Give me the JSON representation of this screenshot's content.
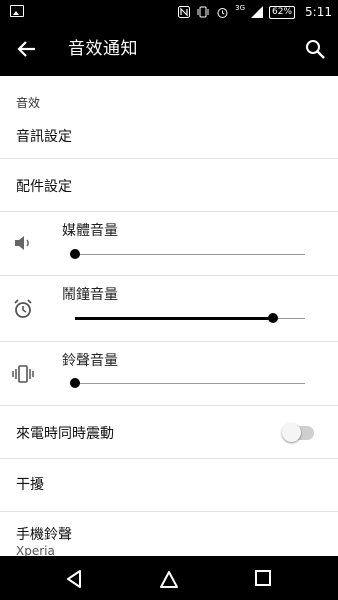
{
  "status_bar": {
    "battery": "62%",
    "time": "5:11",
    "network": "3G",
    "icons": [
      "image-icon",
      "nfc-icon",
      "vibrate-icon",
      "alarm-icon",
      "signal-icon",
      "battery-icon"
    ]
  },
  "app_bar": {
    "title": "音效通知",
    "back_icon": "arrow-back-icon",
    "search_icon": "search-icon"
  },
  "content": {
    "category": "音效",
    "sound_settings": "音訊設定",
    "accessory_settings": "配件設定",
    "sliders": [
      {
        "label": "媒體音量",
        "icon": "speaker-icon",
        "level": 0.0
      },
      {
        "label": "鬧鐘音量",
        "icon": "alarm-clock-icon",
        "level": 0.86
      },
      {
        "label": "鈴聲音量",
        "icon": "vibrate-icon",
        "level": 0.0
      }
    ],
    "vibrate_on_call": {
      "label": "來電時同時震動",
      "on": false
    },
    "do_not_disturb": "干擾",
    "ringtone": {
      "label": "手機鈴聲",
      "value": "Xperia"
    }
  },
  "nav_bar": {
    "back": "nav-back-icon",
    "home": "nav-home-icon",
    "recents": "nav-recents-icon"
  },
  "colors": {
    "bar_background": "#000000",
    "page_background": "#ffffff",
    "slider_active": "#000000"
  }
}
